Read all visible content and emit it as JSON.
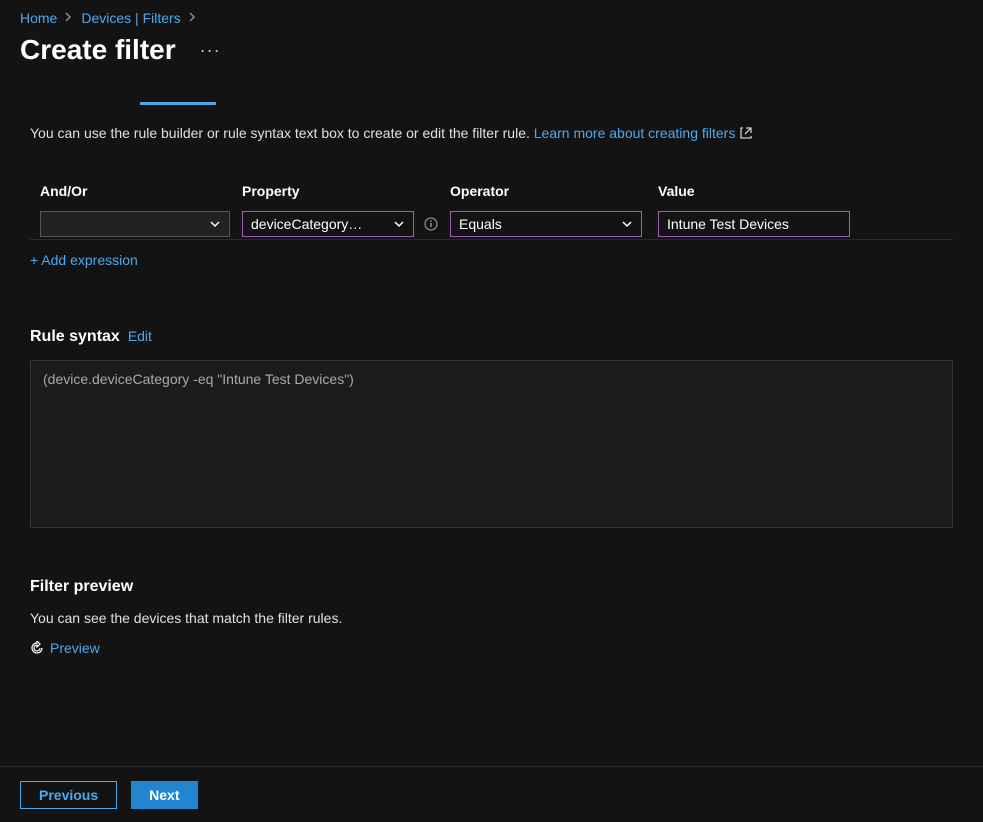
{
  "breadcrumb": {
    "home": "Home",
    "devices_filters": "Devices | Filters"
  },
  "page": {
    "title": "Create filter"
  },
  "intro": {
    "text": "You can use the rule builder or rule syntax text box to create or edit the filter rule. ",
    "link_text": "Learn more about creating filters"
  },
  "rule_builder": {
    "headers": {
      "andor": "And/Or",
      "property": "Property",
      "operator": "Operator",
      "value": "Value"
    },
    "row": {
      "andor": "",
      "property": "deviceCategory…",
      "operator": "Equals",
      "value": "Intune Test Devices"
    },
    "add_expression": "+ Add expression"
  },
  "rule_syntax": {
    "header": "Rule syntax",
    "edit": "Edit",
    "content": "(device.deviceCategory -eq \"Intune Test Devices\")"
  },
  "filter_preview": {
    "header": "Filter preview",
    "description": "You can see the devices that match the filter rules.",
    "preview_link": "Preview"
  },
  "footer": {
    "previous": "Previous",
    "next": "Next"
  }
}
